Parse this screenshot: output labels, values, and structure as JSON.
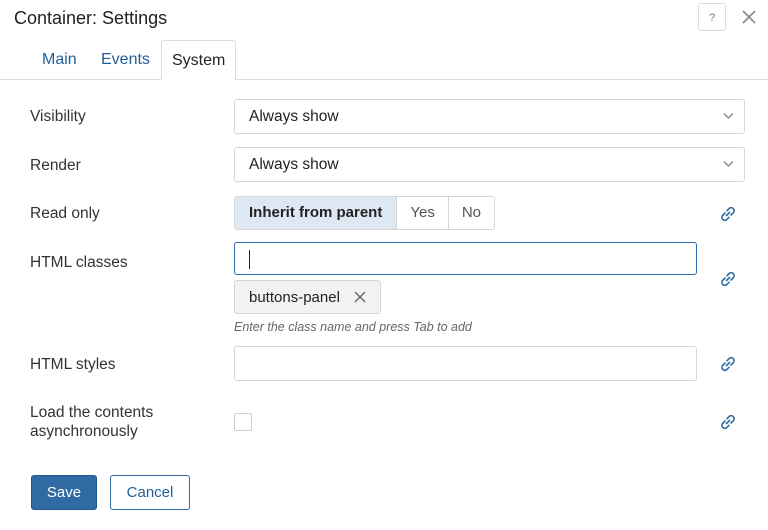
{
  "dialog": {
    "title": "Container: Settings",
    "help_label": "?",
    "close_icon": "close-icon"
  },
  "tabs": [
    {
      "label": "Main",
      "active": false
    },
    {
      "label": "Events",
      "active": false
    },
    {
      "label": "System",
      "active": true
    }
  ],
  "fields": {
    "visibility": {
      "label": "Visibility",
      "value": "Always show"
    },
    "render": {
      "label": "Render",
      "value": "Always show"
    },
    "read_only": {
      "label": "Read only",
      "options": [
        "Inherit from parent",
        "Yes",
        "No"
      ],
      "selected": "Inherit from parent"
    },
    "html_classes": {
      "label": "HTML classes",
      "value": "",
      "tags": [
        "buttons-panel"
      ],
      "hint": "Enter the class name and press Tab to add"
    },
    "html_styles": {
      "label": "HTML styles",
      "value": ""
    },
    "load_async": {
      "label_line1": "Load the contents",
      "label_line2": "asynchronously",
      "checked": false
    }
  },
  "actions": {
    "save_label": "Save",
    "cancel_label": "Cancel"
  },
  "colors": {
    "accent": "#2f6aa3",
    "link": "#1f5f98",
    "selected_segment": "#dde8f3"
  }
}
